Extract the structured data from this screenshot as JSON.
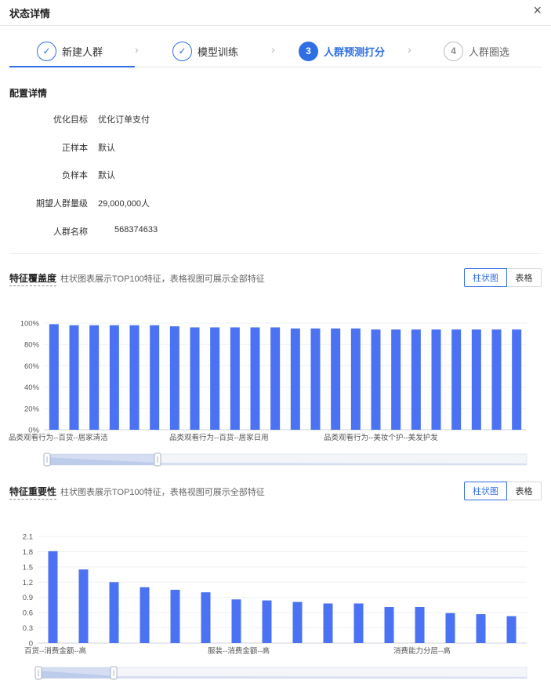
{
  "header": {
    "title": "状态详情"
  },
  "steps": [
    {
      "num": "✓",
      "label": "新建人群",
      "state": "done"
    },
    {
      "num": "✓",
      "label": "模型训练",
      "state": "done"
    },
    {
      "num": "3",
      "label": "人群预测打分",
      "state": "active"
    },
    {
      "num": "4",
      "label": "人群圈选",
      "state": "todo"
    }
  ],
  "config": {
    "title": "配置详情",
    "rows": [
      {
        "key": "优化目标",
        "value": "优化订单支付"
      },
      {
        "key": "正样本",
        "value": "默认"
      },
      {
        "key": "负样本",
        "value": "默认"
      },
      {
        "key": "期望人群量级",
        "value": "29,000,000人"
      },
      {
        "key": "人群名称",
        "value": "568374633"
      }
    ]
  },
  "coverage": {
    "title": "特征覆盖度",
    "desc": "柱状图表展示TOP100特征，表格视图可展示全部特征",
    "btn_bar": "柱状图",
    "btn_table": "表格"
  },
  "importance": {
    "title": "特征重要性",
    "desc": "柱状图表展示TOP100特征，表格视图可展示全部特征",
    "btn_bar": "柱状图",
    "btn_table": "表格"
  },
  "colors": {
    "accent": "#2f6fe3",
    "bar": "#4b72f2"
  },
  "chart_data": [
    {
      "type": "bar",
      "title": "",
      "ylim": [
        0,
        100
      ],
      "yticks": [
        "0%",
        "20%",
        "40%",
        "60%",
        "80%",
        "100%"
      ],
      "x_tick_labels": [
        "品类观看行为--百货--居家清洁",
        "品类观看行为--百货--居家日用",
        "品类观看行为--美妆个护--美发护发"
      ],
      "values": [
        99,
        98,
        98,
        98,
        98,
        98,
        97,
        96,
        96,
        96,
        96,
        96,
        95,
        95,
        95,
        95,
        94,
        94,
        94,
        94,
        94,
        94,
        94,
        94
      ],
      "grid": true
    },
    {
      "type": "bar",
      "title": "",
      "ylim": [
        0,
        2.1
      ],
      "yticks": [
        "0",
        "0.3",
        "0.6",
        "0.9",
        "1.2",
        "1.5",
        "1.8",
        "2.1"
      ],
      "x_tick_labels": [
        "百货--消费金额--高",
        "服装--消费金额--高",
        "消费能力分层--高"
      ],
      "values": [
        1.81,
        1.45,
        1.2,
        1.1,
        1.05,
        1.0,
        0.86,
        0.84,
        0.81,
        0.78,
        0.78,
        0.71,
        0.71,
        0.59,
        0.57,
        0.53
      ],
      "grid": true
    }
  ]
}
